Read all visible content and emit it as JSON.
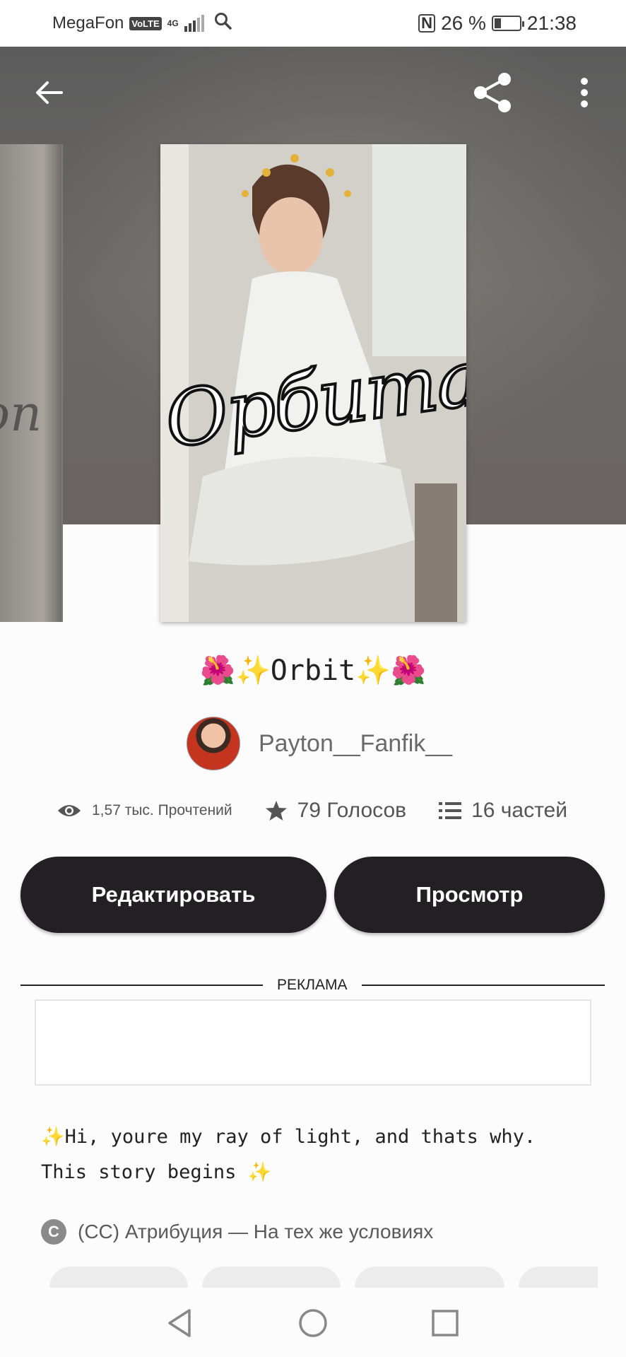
{
  "status_bar": {
    "carrier": "MegaFon",
    "volte": "VoLTE",
    "network": "4G",
    "battery_text": "26 %",
    "battery_level": 0.26,
    "time": "21:38",
    "nfc": "N"
  },
  "hero": {
    "cover_title": "Орбита",
    "cover_left_text": "on"
  },
  "story": {
    "title_prefix": "🌺✨",
    "title": "Orbit",
    "title_suffix": "✨🌺",
    "author": "Payton__Fanfik__",
    "reads": "1,57 тыс. Прочтений",
    "votes": "79 Голосов",
    "parts": "16 частей",
    "description_emoji_start": "✨",
    "description": "Hi, youre my ray of light, and thats why. This story begins",
    "description_emoji_end": "✨",
    "license": "(CC) Атрибуция — На тех же условиях",
    "license_icon": "C"
  },
  "actions": {
    "edit": "Редактировать",
    "view": "Просмотр"
  },
  "ad": {
    "label": "РЕКЛАМА"
  },
  "icons": {
    "back": "arrow-left",
    "share": "share",
    "more": "more-vertical",
    "reads": "eye",
    "votes": "star",
    "parts": "list"
  }
}
